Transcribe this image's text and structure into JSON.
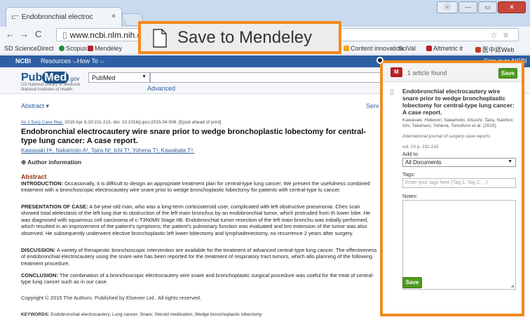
{
  "browser": {
    "tab_title": "Endobronchial electroc",
    "tab_close": "×",
    "url": "www.ncbi.nlm.nih.go",
    "window_buttons": [
      "ⓤ",
      "—",
      "▭",
      "✕"
    ]
  },
  "bookmarks": [
    {
      "label": "SD ScienceDirect",
      "color": "#2a6db3"
    },
    {
      "label": "Scopus",
      "color": "#1f8c3b"
    },
    {
      "label": "Mendeley",
      "color": "#b61f25"
    },
    {
      "label": "Content innovation",
      "color": "#f2a51c"
    },
    {
      "label": "SciVal",
      "color": "#6a7bb0"
    },
    {
      "label": "Altmetric it",
      "color": "#b61f25"
    },
    {
      "label": "医中誌Web",
      "color": "#c23a2a"
    }
  ],
  "ncbi": {
    "logo": "NCBI",
    "resources": "Resources ⌵",
    "howto": "How To ⌵",
    "signin": "Sign in to NCBI"
  },
  "pubmed": {
    "logo_pub": "Pub",
    "logo_med": "Med",
    "logo_gov": ".gov",
    "subtitle1": "US National Library of Medicine",
    "subtitle2": "National Institutes of Health",
    "db_select": "PubMed",
    "advanced": "Advanced"
  },
  "article": {
    "display_format": "Abstract ▾",
    "send_to": "Send",
    "citation_journal": "Int J Surg Case Rep.",
    "citation_rest": " 2015 Apr 8;10:211-215. doi: 10.1016/j.ijscr.2015.04.008. [Epub ahead of print]",
    "title": "Endobronchial electrocautery wire snare prior to wedge bronchoplastic lobectomy for central-type lung cancer: A case report.",
    "authors": "Kawasaki H¹, Nakamoto A², Taira N³, Ichi T³, Yohena T³, Kawabata T³.",
    "author_info": "⊕ Author information",
    "abstract_heading": "Abstract",
    "introduction_label": "INTRODUCTION:",
    "introduction_text": " Occasionally, it is difficult to design an appropriate treatment plan for central-type lung cancer. We present the usefulness combined treatment with a bronchoscopic electrocautery wire snare prior to wedge bronchoplastic lobectomy for patients with central-type lu cancer.",
    "presentation_label": "PRESENTATION OF CASE:",
    "presentation_text": " A 64-year-old man, who was a long-term corticosteroid user, complicated with left obstructive pneumonia. Ches scan showed total atelectasis of the left lung due to obstruction of the left main bronchus by an endobronchial tumor, which protruded from th lower lobe. He was diagnosed with squamous cell carcinoma of c-T3N0M0 Stage IIB. Endobronchial tumor resection of the left main bronchu was initially performed, which resulted in an improvement of the patient's symptoms; the patient's pulmonary function was evaluated and bro extension of the tumor was also observed. He subsequently underwent elective bronchoplastic left lower lobectomy and lymphadenectomy, no recurrence 2 years after surgery.",
    "discussion_label": "DISCUSSION:",
    "discussion_text": " A variety of therapeutic bronchoscopic intervention are available for the treatment of advanced central-type lung cancer. The effectiveness of endobronchial electrocautery using the snare wire has been reported for the treatment of respiratory tract tumors, which allo planning of the following treatment procedure.",
    "conclusion_label": "CONCLUSION:",
    "conclusion_text": " The combination of a bronchoscopic electrocautery wire snare and bronchoplastic surgical procedure was useful for the treat of central-type lung cancer such as in our case.",
    "copyright": "Copyright © 2015 The Authors. Published by Elsevier Ltd.. All rights reserved.",
    "keywords_label": "KEYWORDS:",
    "keywords": " Endobronchial electrocautery; Lung cancer; Snare; Steroid medication; Wedge bronchoplastic lobectomy"
  },
  "callout": {
    "label": "Save to Mendeley"
  },
  "panel": {
    "logo": "M",
    "found": "1 article found",
    "save_top": "Save",
    "article_title": "Endobronchial electrocautery wire snare prior to wedge bronchoplastic lobectomy for central-type lung cancer: A case report.",
    "article_authors": "Kawasaki, Hidenori; Nakamoto, Atsushi; Taira, Naohiro; Ichi, Takaharu; Yohena, Tomofumi et al. (2015)",
    "article_journal": "International journal of surgery case reports",
    "article_vol": "vol. 10 p. 211-215",
    "addto_label": "Add to:",
    "addto_value": "All Documents",
    "tags_label": "Tags:",
    "tags_placeholder": "Enter your tags here (Tag 1; Tag 2; ...)",
    "notes_label": "Notes:",
    "save_bottom": "Save"
  }
}
